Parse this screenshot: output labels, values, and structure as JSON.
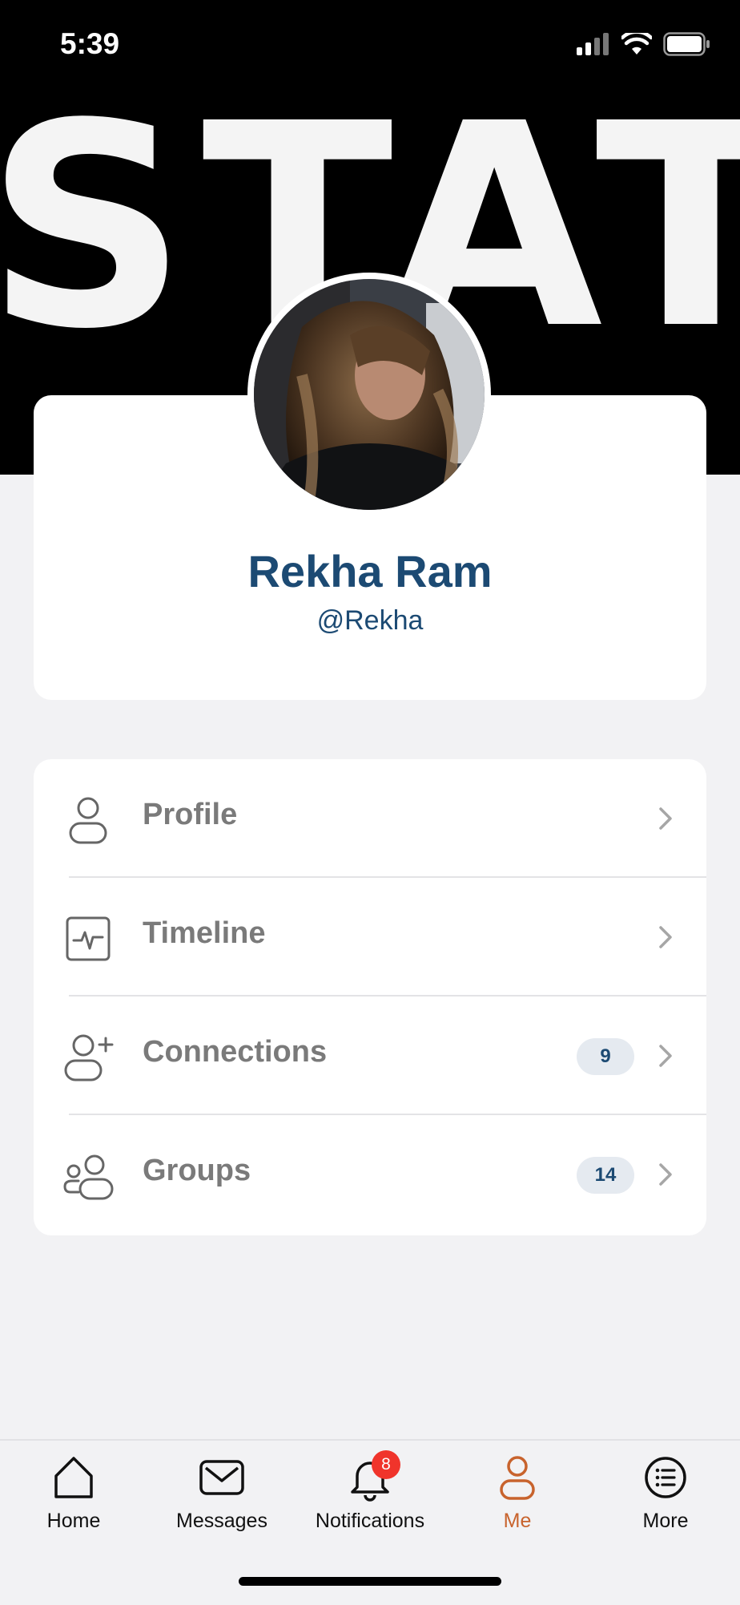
{
  "status_bar": {
    "time": "5:39"
  },
  "cover": {
    "text": "STAT"
  },
  "user": {
    "name": "Rekha Ram",
    "handle": "@Rekha"
  },
  "menu": [
    {
      "label": "Profile",
      "icon": "person-icon",
      "badge": ""
    },
    {
      "label": "Timeline",
      "icon": "activity-icon",
      "badge": ""
    },
    {
      "label": "Connections",
      "icon": "person-add-icon",
      "badge": "9"
    },
    {
      "label": "Groups",
      "icon": "group-icon",
      "badge": "14"
    }
  ],
  "tabs": [
    {
      "label": "Home",
      "icon": "home-icon"
    },
    {
      "label": "Messages",
      "icon": "mail-icon"
    },
    {
      "label": "Notifications",
      "icon": "bell-icon",
      "badge": "8"
    },
    {
      "label": "Me",
      "icon": "person-icon",
      "active": true
    },
    {
      "label": "More",
      "icon": "list-icon"
    }
  ],
  "colors": {
    "accent": "#c8632d",
    "name": "#1c4a73",
    "badge": "#f0342b"
  }
}
